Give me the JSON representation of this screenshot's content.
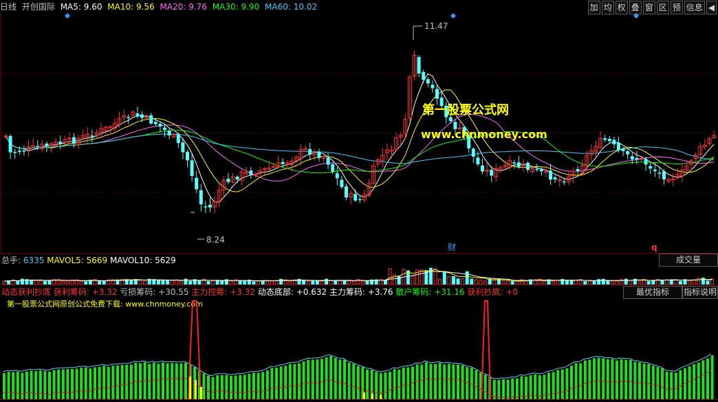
{
  "header": {
    "period": "日线",
    "stock_name": "开创国际",
    "ma": [
      {
        "label": "MA5: 9.60",
        "color": "#ffffff"
      },
      {
        "label": "MA10: 9.56",
        "color": "#ffff00"
      },
      {
        "label": "MA20: 9.76",
        "color": "#ff66ff"
      },
      {
        "label": "MA30: 9.90",
        "color": "#00ff00"
      },
      {
        "label": "MA60: 10.02",
        "color": "#44ccff"
      }
    ]
  },
  "toolbar": [
    "加",
    "均",
    "权",
    "叠",
    "窗",
    "区",
    "预",
    "信息",
    "◀"
  ],
  "main_chart": {
    "high_label": "11.47",
    "low_label": "8.24",
    "watermark_title": "第一股票公式网",
    "watermark_url": "www.chnmoney.com",
    "marker_cai": "财",
    "marker_q": "q"
  },
  "volume_panel": {
    "label_total": "总手: ",
    "value_total": "6335",
    "label_mavol5": "MAVOL5: ",
    "value_mavol5": "5669",
    "label_mavol10": "MAVOL10: ",
    "value_mavol10": "5629",
    "button": "成交量"
  },
  "indicator_panel": {
    "items": [
      {
        "text": "动态获利抄底",
        "color": "#ff3030"
      },
      {
        "text": " 获利筹码: +3.32",
        "color": "#ff3030"
      },
      {
        "text": " 亏损筹码: +30.55",
        "color": "#c0c0c0"
      },
      {
        "text": " 主力控筹: +3.32",
        "color": "#ff3030"
      },
      {
        "text": " 动态底部: +0.632",
        "color": "#ffffff"
      },
      {
        "text": " 主力筹码: +3.76",
        "color": "#ffffff"
      },
      {
        "text": " 散户筹码: +31.16",
        "color": "#00ff00"
      },
      {
        "text": " 获利抄底: +0",
        "color": "#ff3030"
      }
    ],
    "subtitle": "第一股票公式网原创公式免费下载: www.chnmoney.com",
    "button_best": "最优指标",
    "button_help": "指标说明"
  },
  "chart_data": {
    "type": "candlestick",
    "price_range": [
      8.24,
      11.47
    ],
    "high_value": 11.47,
    "low_value": 8.24,
    "ma_last": {
      "MA5": 9.6,
      "MA10": 9.56,
      "MA20": 9.76,
      "MA30": 9.9,
      "MA60": 10.02
    },
    "volume_last": {
      "total": 6335,
      "MAVOL5": 5669,
      "MAVOL10": 5629
    }
  }
}
